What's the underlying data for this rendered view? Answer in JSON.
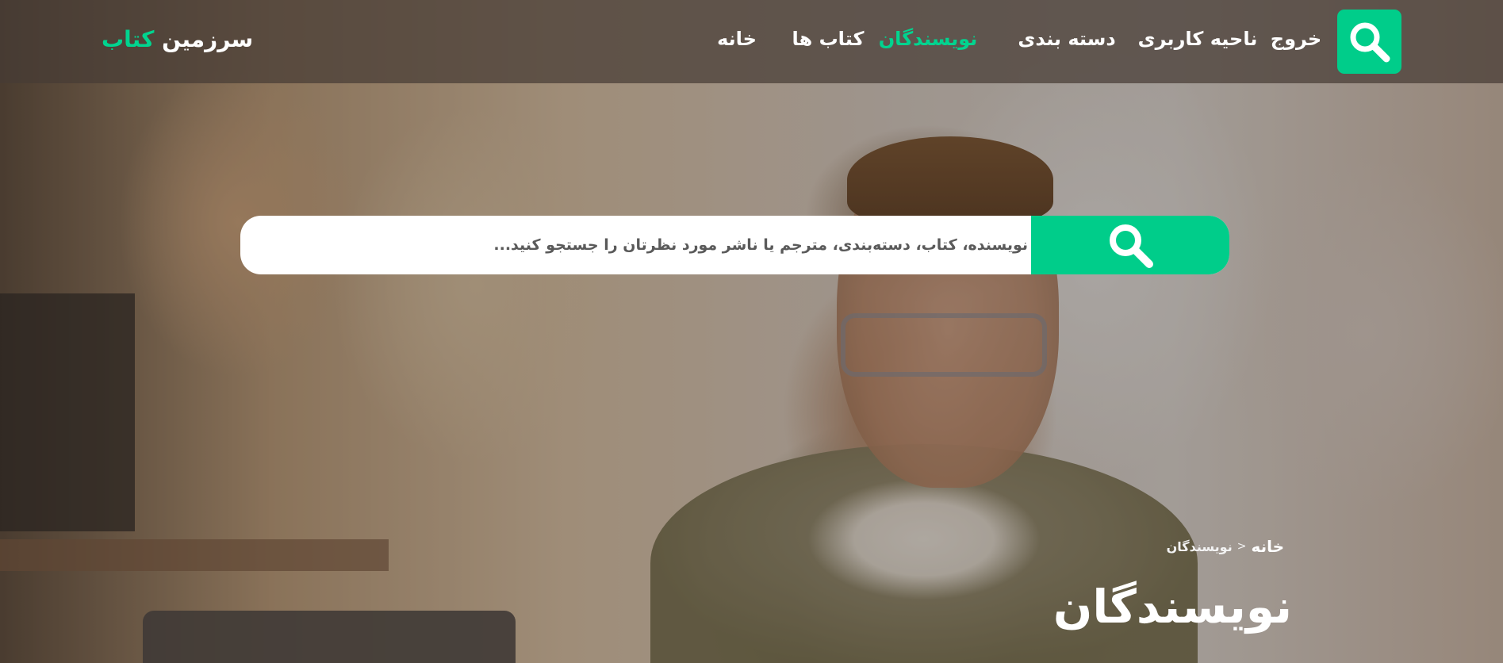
{
  "brand": {
    "name_part": "سرزمین",
    "accent_part": "کتاب"
  },
  "nav": {
    "items": [
      {
        "label": "خروج",
        "active": false
      },
      {
        "label": "ناحیه کاربری",
        "active": false
      },
      {
        "label": "دسته بندی",
        "active": false
      },
      {
        "label": "نویسندگان",
        "active": true
      },
      {
        "label": "کتاب ها",
        "active": false
      },
      {
        "label": "خانه",
        "active": false
      }
    ]
  },
  "search": {
    "placeholder": "نویسنده، کتاب، دسته‌بندی، مترجم یا ناشر مورد نظرتان را جستجو کنید...",
    "value": ""
  },
  "breadcrumb": {
    "home": "خانه",
    "separator": "<",
    "current": "نویسندگان"
  },
  "page": {
    "title": "نویسندگان"
  },
  "colors": {
    "accent": "#00cd8a",
    "nav_active": "#00d48f",
    "text_light": "#ffffff"
  },
  "icons": {
    "nav_search": "search-icon",
    "hero_search": "search-icon"
  }
}
